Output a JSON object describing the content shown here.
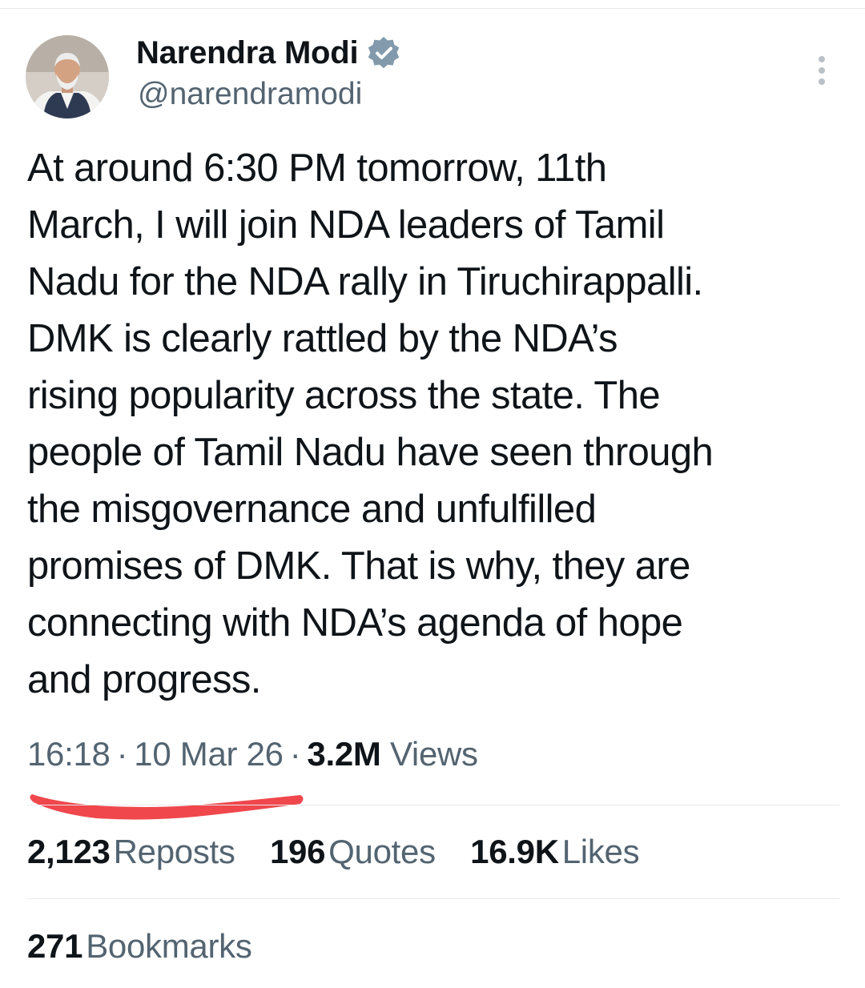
{
  "author": {
    "display_name": "Narendra Modi",
    "handle": "@narendramodi",
    "avatar_icon": "profile-photo",
    "verified_icon": "verified-badge-icon"
  },
  "tweet": {
    "text": "At around 6:30 PM tomorrow, 11th\nMarch, I will join NDA leaders of Tamil\nNadu for the NDA rally in Tiruchirappalli.\nDMK is clearly rattled by the NDA’s\nrising popularity across the state. The\npeople of Tamil Nadu have seen through\nthe misgovernance and unfulfilled\npromises of DMK. That is why, they are\nconnecting with NDA’s agenda of hope\nand progress."
  },
  "meta": {
    "time": "16:18",
    "separator": "·",
    "date": "10 Mar 26",
    "views_count": "3.2M",
    "views_label": "Views"
  },
  "stats": {
    "reposts_count": "2,123",
    "reposts_label": "Reposts",
    "quotes_count": "196",
    "quotes_label": "Quotes",
    "likes_count": "16.9K",
    "likes_label": "Likes",
    "bookmarks_count": "271",
    "bookmarks_label": "Bookmarks"
  },
  "colors": {
    "text_primary": "#0f1419",
    "text_secondary": "#536471",
    "verified_badge": "#829aab",
    "annotation_red": "#f0474c",
    "divider": "#e7e9eb"
  }
}
